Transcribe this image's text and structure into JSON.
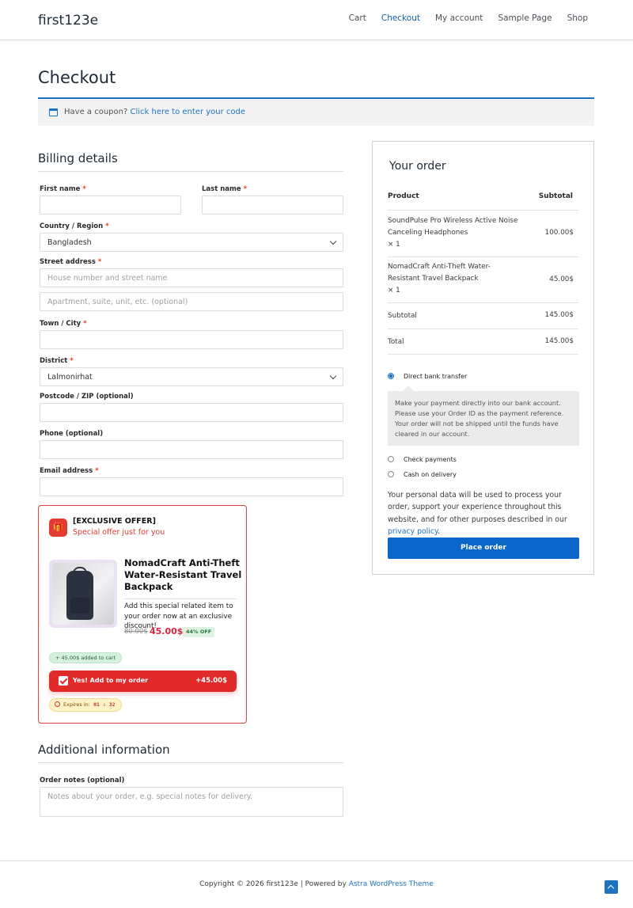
{
  "site": {
    "title": "first123e"
  },
  "nav": {
    "items": [
      "Cart",
      "Checkout",
      "My account",
      "Sample Page",
      "Shop"
    ],
    "active": "Checkout"
  },
  "page": {
    "title": "Checkout"
  },
  "coupon": {
    "text": "Have a coupon?",
    "link": "Click here to enter your code"
  },
  "billing": {
    "heading": "Billing details",
    "first_name_label": "First name",
    "last_name_label": "Last name",
    "country_label": "Country / Region",
    "country_value": "Bangladesh",
    "street_label": "Street address",
    "street_placeholder": "House number and street name",
    "street2_placeholder": "Apartment, suite, unit, etc. (optional)",
    "town_label": "Town / City",
    "district_label": "District",
    "district_value": "Lalmonirhat",
    "postcode_label": "Postcode / ZIP (optional)",
    "phone_label": "Phone (optional)",
    "email_label": "Email address",
    "required_mark": "*"
  },
  "offer": {
    "heading": "[EXCLUSIVE OFFER]",
    "subheading": "Special offer just for you",
    "product_title": "NomadCraft Anti-Theft Water-Resistant Travel Backpack",
    "description": "Add this special related item to your order now at an exclusive discount!",
    "old_price": "80.00$",
    "new_price": "45.00$",
    "discount": "44% OFF",
    "added_notice": "+ 45.00$ added to cart",
    "button_label": "Yes! Add to my order",
    "button_amount": "+45.00$",
    "expires_label": "Expires in:",
    "timer": "01 : 32",
    "accent_color": "#e12b2b"
  },
  "additional": {
    "heading": "Additional information",
    "notes_label": "Order notes (optional)",
    "notes_placeholder": "Notes about your order, e.g. special notes for delivery."
  },
  "order": {
    "heading": "Your order",
    "col_product": "Product",
    "col_subtotal": "Subtotal",
    "items": [
      {
        "name": "SoundPulse Pro Wireless Active Noise Canceling Headphones",
        "qty": "× 1",
        "price": "100.00$"
      },
      {
        "name": "NomadCraft Anti-Theft Water-Resistant Travel Backpack",
        "qty": "× 1",
        "price": "45.00$"
      }
    ],
    "subtotal_label": "Subtotal",
    "subtotal_value": "145.00$",
    "total_label": "Total",
    "total_value": "145.00$",
    "payment_methods": [
      {
        "label": "Direct bank transfer",
        "selected": true
      },
      {
        "label": "Check payments",
        "selected": false
      },
      {
        "label": "Cash on delivery",
        "selected": false
      }
    ],
    "bank_description": "Make your payment directly into our bank account. Please use your Order ID as the payment reference. Your order will not be shipped until the funds have cleared in our account.",
    "privacy_text": "Your personal data will be used to process your order, support your experience throughout this website, and for other purposes described in our",
    "privacy_link": "privacy policy",
    "privacy_end": ".",
    "place_order": "Place order",
    "button_color": "#0b66c9"
  },
  "footer": {
    "copyright": "Copyright © 2026 first123e | Powered by",
    "theme_link": "Astra WordPress Theme"
  }
}
